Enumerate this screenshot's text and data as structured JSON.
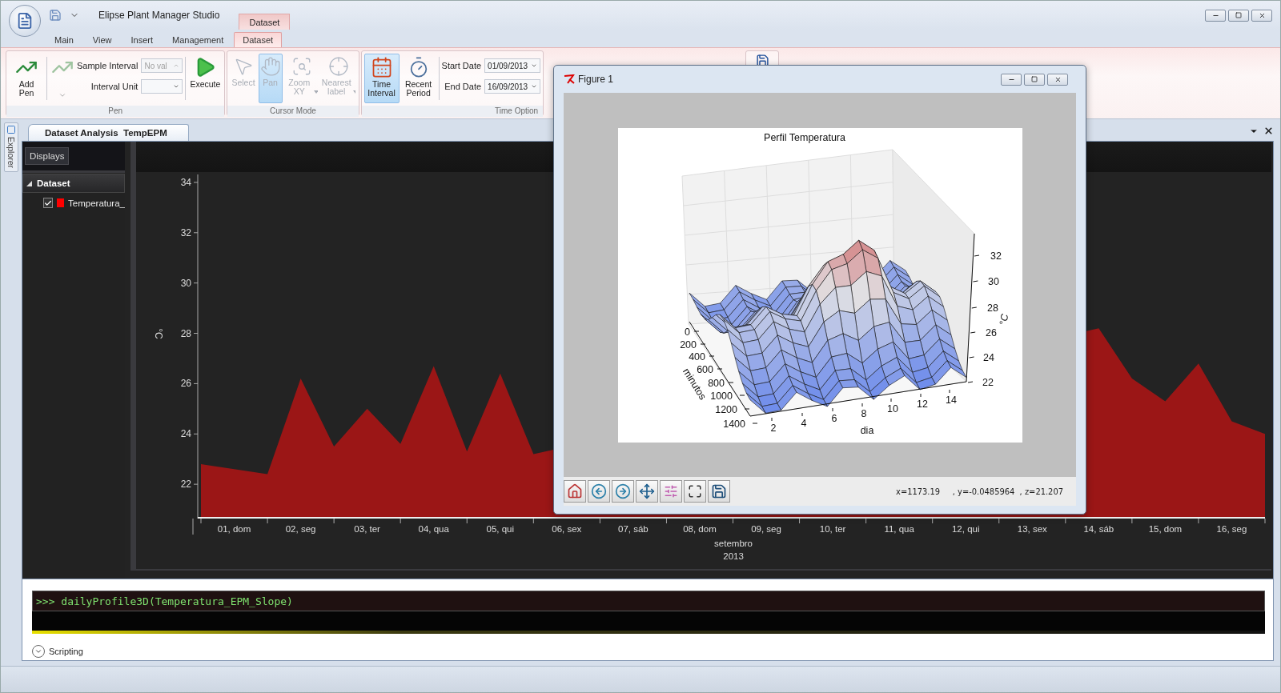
{
  "app": {
    "title": "Elipse Plant Manager Studio",
    "context_group": "Dataset"
  },
  "tabs": [
    {
      "label": "Main",
      "selected": false
    },
    {
      "label": "View",
      "selected": false
    },
    {
      "label": "Insert",
      "selected": false
    },
    {
      "label": "Management",
      "selected": false
    },
    {
      "label": "Dataset",
      "selected": true
    }
  ],
  "ribbon": {
    "pen_group": {
      "label": "Pen",
      "add_pen": "Add Pen",
      "sample_interval_label": "Sample Interval",
      "sample_interval_value": "No val",
      "interval_unit_label": "Interval Unit",
      "execute": "Execute"
    },
    "cursor_group": {
      "label": "Cursor Mode",
      "tools": [
        {
          "kind": "select",
          "label": "Select",
          "selected": false,
          "disabled": true,
          "dropdown": false
        },
        {
          "kind": "pan",
          "label": "Pan",
          "selected": true,
          "disabled": true,
          "dropdown": false
        },
        {
          "kind": "zoom",
          "label": "Zoom XY",
          "selected": false,
          "disabled": true,
          "dropdown": true
        },
        {
          "kind": "nearest",
          "label": "Nearest label",
          "selected": false,
          "disabled": true,
          "dropdown": true
        }
      ]
    },
    "time_group": {
      "label": "Time Option",
      "modes": [
        {
          "kind": "interval",
          "label": "Time Interval",
          "selected": true
        },
        {
          "kind": "recent",
          "label": "Recent Period",
          "selected": false
        }
      ],
      "start_date_label": "Start Date",
      "start_date": "01/09/2013",
      "end_date_label": "End Date",
      "end_date": "16/09/2013"
    }
  },
  "document": {
    "explorer_tab": "Explorer",
    "tab": "Dataset Analysis  TempEPM"
  },
  "sidebar": {
    "displays_button": "Displays",
    "section": {
      "label": "Dataset",
      "expanded": true
    },
    "pens": [
      {
        "checked": true,
        "color": "#ff0000"
      }
    ]
  },
  "trend": {
    "month": "setembro",
    "year": "2013",
    "chart_data": {
      "type": "area",
      "ylabel": "°C",
      "xlim": [
        0,
        16
      ],
      "ylim": [
        20.7,
        34.3
      ],
      "yticks": [
        22,
        24,
        26,
        28,
        30,
        32,
        34
      ],
      "xticks": [
        {
          "value": 0.5,
          "label": "01, dom"
        },
        {
          "value": 1.5,
          "label": "02, seg"
        },
        {
          "value": 2.5,
          "label": "03, ter"
        },
        {
          "value": 3.5,
          "label": "04, qua"
        },
        {
          "value": 4.5,
          "label": "05, qui"
        },
        {
          "value": 5.5,
          "label": "06, sex"
        },
        {
          "value": 6.5,
          "label": "07, sáb"
        },
        {
          "value": 7.5,
          "label": "08, dom"
        },
        {
          "value": 8.5,
          "label": "09, seg"
        },
        {
          "value": 9.5,
          "label": "10, ter"
        },
        {
          "value": 10.5,
          "label": "11, qua"
        },
        {
          "value": 11.5,
          "label": "12, qui"
        },
        {
          "value": 12.5,
          "label": "13, sex"
        },
        {
          "value": 13.5,
          "label": "14, sáb"
        },
        {
          "value": 14.5,
          "label": "15, dom"
        },
        {
          "value": 15.5,
          "label": "16, seg"
        }
      ],
      "x": [
        0,
        0.5,
        1,
        1.5,
        2,
        2.5,
        3,
        3.5,
        4,
        4.5,
        5,
        5.5,
        6,
        6.5,
        7,
        7.5,
        8,
        8.5,
        9,
        9.5,
        10,
        10.5,
        11,
        11.5,
        12,
        12.5,
        13,
        13.5,
        14,
        14.5,
        15,
        15.5,
        16
      ],
      "series": [
        {
          "name": "Temperatura_",
          "color": "#9b1616",
          "values": [
            22.8,
            22.6,
            22.4,
            26.2,
            23.5,
            25.0,
            23.6,
            26.7,
            23.3,
            26.4,
            23.2,
            null,
            null,
            null,
            null,
            null,
            null,
            null,
            null,
            null,
            null,
            null,
            null,
            null,
            null,
            null,
            null,
            28.2,
            26.2,
            25.3,
            26.8,
            24.5,
            24.0
          ]
        }
      ]
    }
  },
  "figure": {
    "title": "Figure 1",
    "plot": {
      "title": "Perfil Temperatura",
      "z_label": "°C",
      "z_ticks": [
        "32",
        "30",
        "28",
        "26",
        "24",
        "22"
      ],
      "x_label": "dia",
      "x_ticks": [
        "2",
        "4",
        "6",
        "8",
        "10",
        "12",
        "14"
      ],
      "y_label": "minutos",
      "y_ticks": [
        "0",
        "200",
        "400",
        "600",
        "800",
        "1000",
        "1200",
        "1400"
      ]
    },
    "coordinates": "x=1173.19     , y=-0.0485964  , z=21.207"
  },
  "console": {
    "command": ">>> dailyProfile3D(Temperatura_EPM_Slope)"
  },
  "scripting": {
    "label": "Scripting",
    "expanded": false
  }
}
